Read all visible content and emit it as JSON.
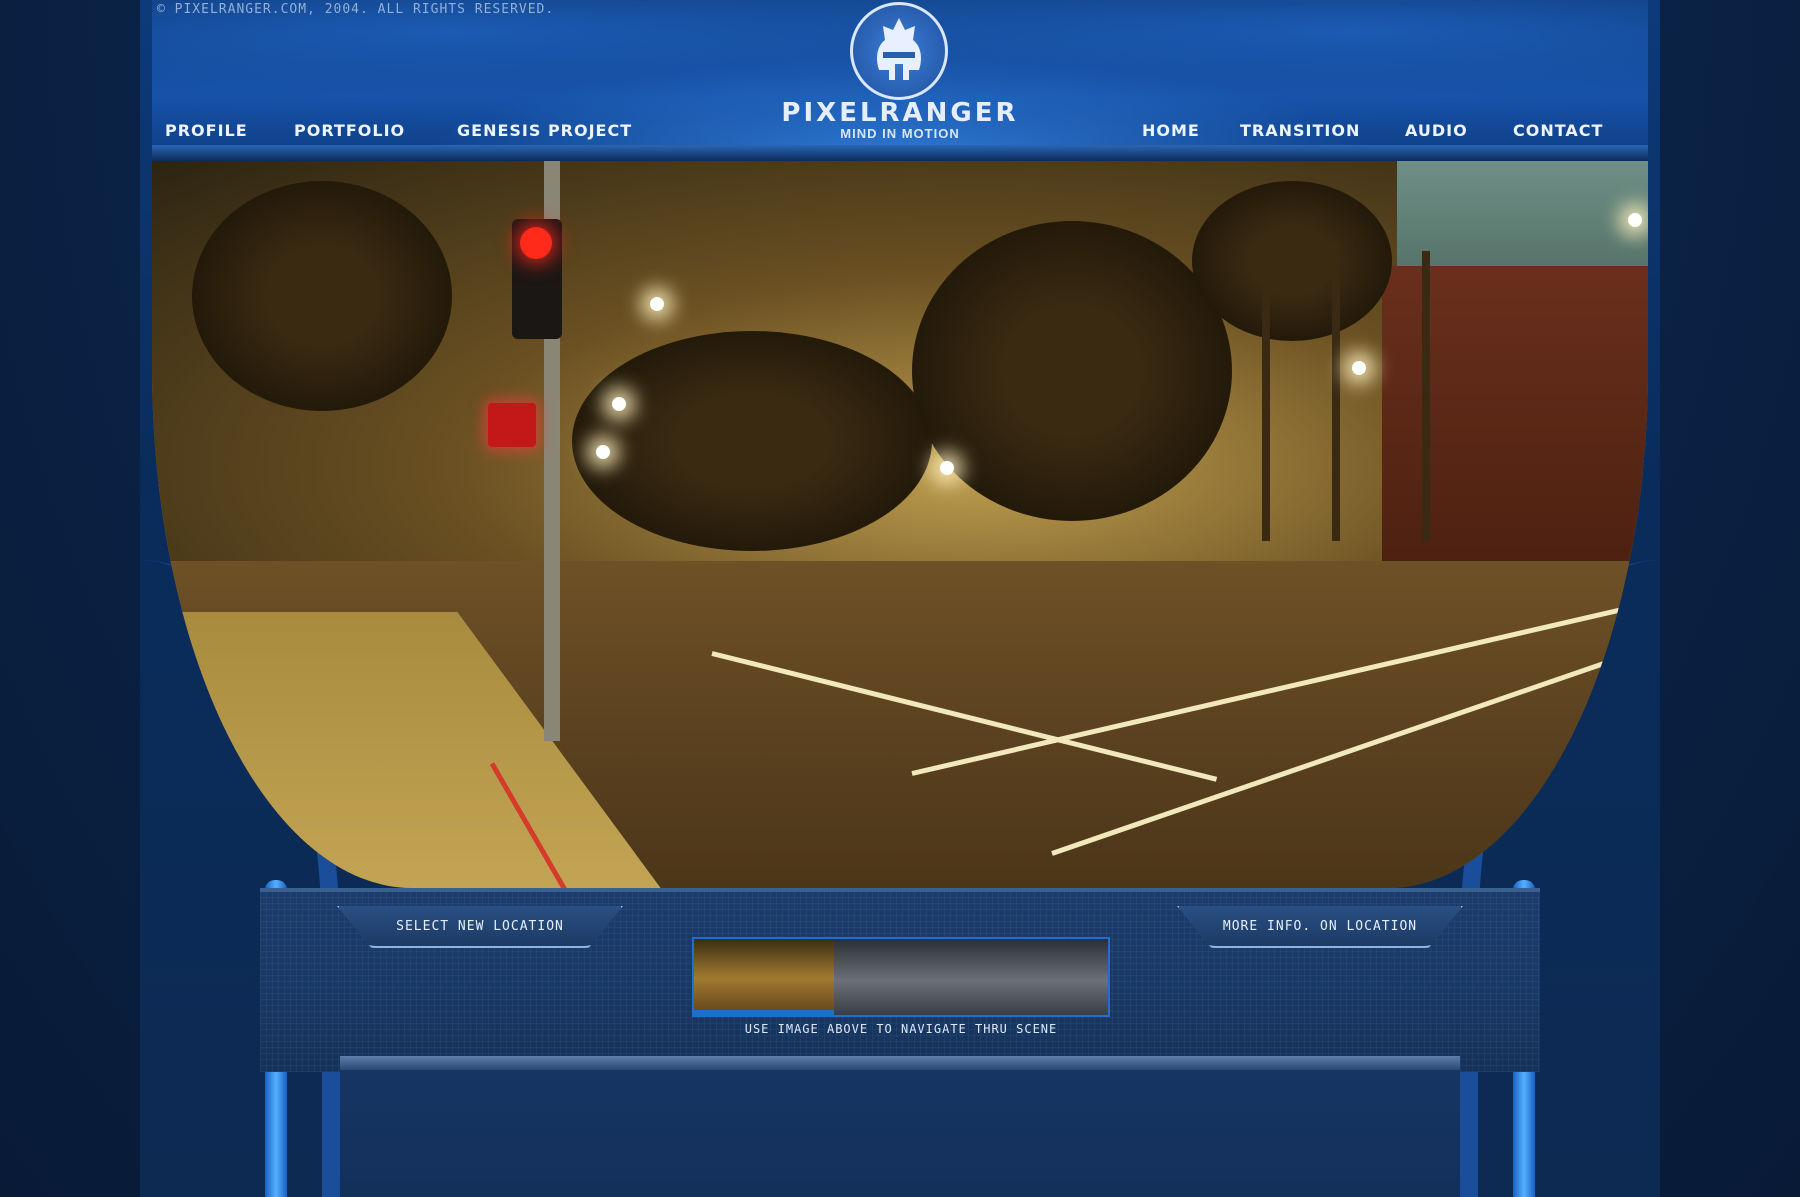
{
  "header": {
    "copyright": "© PIXELRANGER.COM, 2004. ALL RIGHTS RESERVED.",
    "brand": "PIXELRANGER",
    "tagline": "MIND IN MOTION"
  },
  "nav_left": [
    {
      "label": "PROFILE"
    },
    {
      "label": "PORTFOLIO"
    },
    {
      "label": "GENESIS PROJECT"
    }
  ],
  "nav_right": [
    {
      "label": "HOME"
    },
    {
      "label": "TRANSITION"
    },
    {
      "label": "AUDIO"
    },
    {
      "label": "CONTACT"
    }
  ],
  "console": {
    "select_location": "SELECT NEW LOCATION",
    "more_info": "MORE INFO. ON LOCATION",
    "hint": "USE IMAGE ABOVE TO NAVIGATE THRU SCENE"
  },
  "icons": {
    "logo": "helmet-icon"
  },
  "colors": {
    "accent": "#1e6fd0",
    "background": "#0b2347"
  }
}
